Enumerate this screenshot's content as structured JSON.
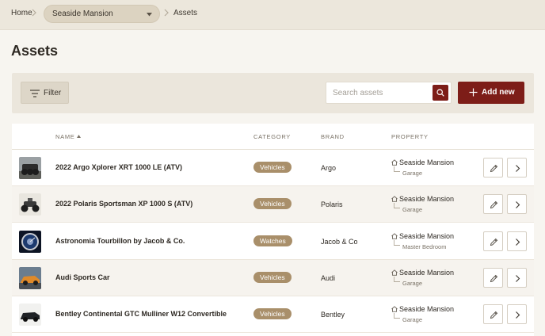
{
  "breadcrumb": {
    "home": "Home",
    "property_select": "Seaside Mansion",
    "current": "Assets"
  },
  "page": {
    "title": "Assets"
  },
  "toolbar": {
    "filter_label": "Filter",
    "search_placeholder": "Search assets",
    "search_value": "",
    "add_label": "Add new"
  },
  "table": {
    "columns": {
      "name": "NAME",
      "category": "CATEGORY",
      "brand": "BRAND",
      "property": "PROPERTY"
    },
    "sort": {
      "column": "name",
      "direction": "ascending"
    },
    "rows": [
      {
        "name": "2022 Argo Xplorer XRT 1000 LE (ATV)",
        "category": "Vehicles",
        "brand": "Argo",
        "property": "Seaside Mansion",
        "room": "Garage"
      },
      {
        "name": "2022 Polaris Sportsman XP 1000 S (ATV)",
        "category": "Vehicles",
        "brand": "Polaris",
        "property": "Seaside Mansion",
        "room": "Garage"
      },
      {
        "name": "Astronomia Tourbillon by Jacob & Co.",
        "category": "Watches",
        "brand": "Jacob & Co",
        "property": "Seaside Mansion",
        "room": "Master Bedroom"
      },
      {
        "name": "Audi Sports Car",
        "category": "Vehicles",
        "brand": "Audi",
        "property": "Seaside Mansion",
        "room": "Garage"
      },
      {
        "name": "Bentley Continental GTC Mulliner W12 Convertible",
        "category": "Vehicles",
        "brand": "Bentley",
        "property": "Seaside Mansion",
        "room": "Garage"
      }
    ]
  },
  "icons": {
    "filter": "filter-lines-icon",
    "search": "search-icon",
    "add": "plus-icon",
    "edit": "pencil-icon",
    "open": "chevron-right-icon",
    "property": "home-icon"
  },
  "colors": {
    "accent": "#7d1d18",
    "badge": "#a98f6a",
    "topbar": "#ece7dc",
    "toolbar": "#ebe6dc"
  }
}
